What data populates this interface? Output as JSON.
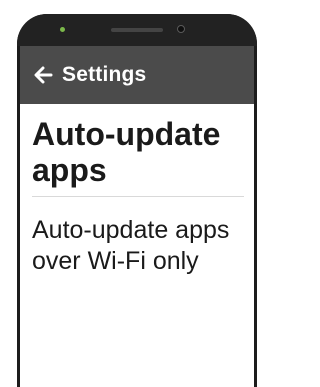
{
  "app_bar": {
    "back_icon": "arrow-left-icon",
    "title": "Settings"
  },
  "main": {
    "heading": "Auto-update apps",
    "option_label": "Auto-update apps over Wi-Fi only"
  },
  "colors": {
    "app_bar_bg": "#4b4b4b",
    "bezel": "#1c1c1c",
    "sensor": "#7bb84a",
    "text": "#1a1a1a"
  }
}
